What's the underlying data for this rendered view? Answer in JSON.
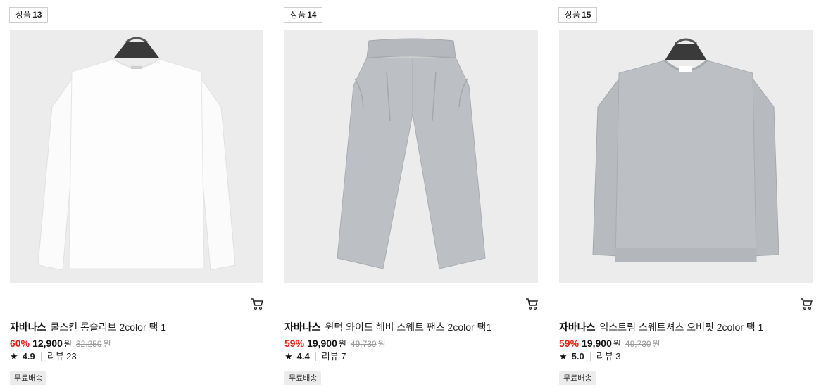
{
  "products": [
    {
      "rank_label": "상품",
      "rank_number": "13",
      "brand": "자바나스",
      "name": "쿨스킨 롱슬리브 2color 택 1",
      "discount": "60%",
      "sale_price": "12,900",
      "currency": "원",
      "original_price": "32,250",
      "original_currency": "원",
      "star": "★",
      "rating": "4.9",
      "review_label": "리뷰",
      "review_count": "23",
      "badge": "무료배송",
      "cart_icon": "shopping-cart-icon",
      "garment": "white long sleeve tee"
    },
    {
      "rank_label": "상품",
      "rank_number": "14",
      "brand": "자바나스",
      "name": "윈턱 와이드 헤비 스웨트 팬츠 2color 택1",
      "discount": "59%",
      "sale_price": "19,900",
      "currency": "원",
      "original_price": "49,730",
      "original_currency": "원",
      "star": "★",
      "rating": "4.4",
      "review_label": "리뷰",
      "review_count": "7",
      "badge": "무료배송",
      "cart_icon": "shopping-cart-icon",
      "garment": "grey wide sweat pants"
    },
    {
      "rank_label": "상품",
      "rank_number": "15",
      "brand": "자바나스",
      "name": "익스트림 스웨트셔츠 오버핏 2color 택 1",
      "discount": "59%",
      "sale_price": "19,900",
      "currency": "원",
      "original_price": "49,730",
      "original_currency": "원",
      "star": "★",
      "rating": "5.0",
      "review_label": "리뷰",
      "review_count": "3",
      "badge": "무료배송",
      "cart_icon": "shopping-cart-icon",
      "garment": "grey crewneck sweatshirt"
    }
  ],
  "colors": {
    "discount": "#e2231a",
    "thumb_bg": "#ececec",
    "garment_grey": "#b9bcc1",
    "garment_white": "#fbfbfb"
  }
}
